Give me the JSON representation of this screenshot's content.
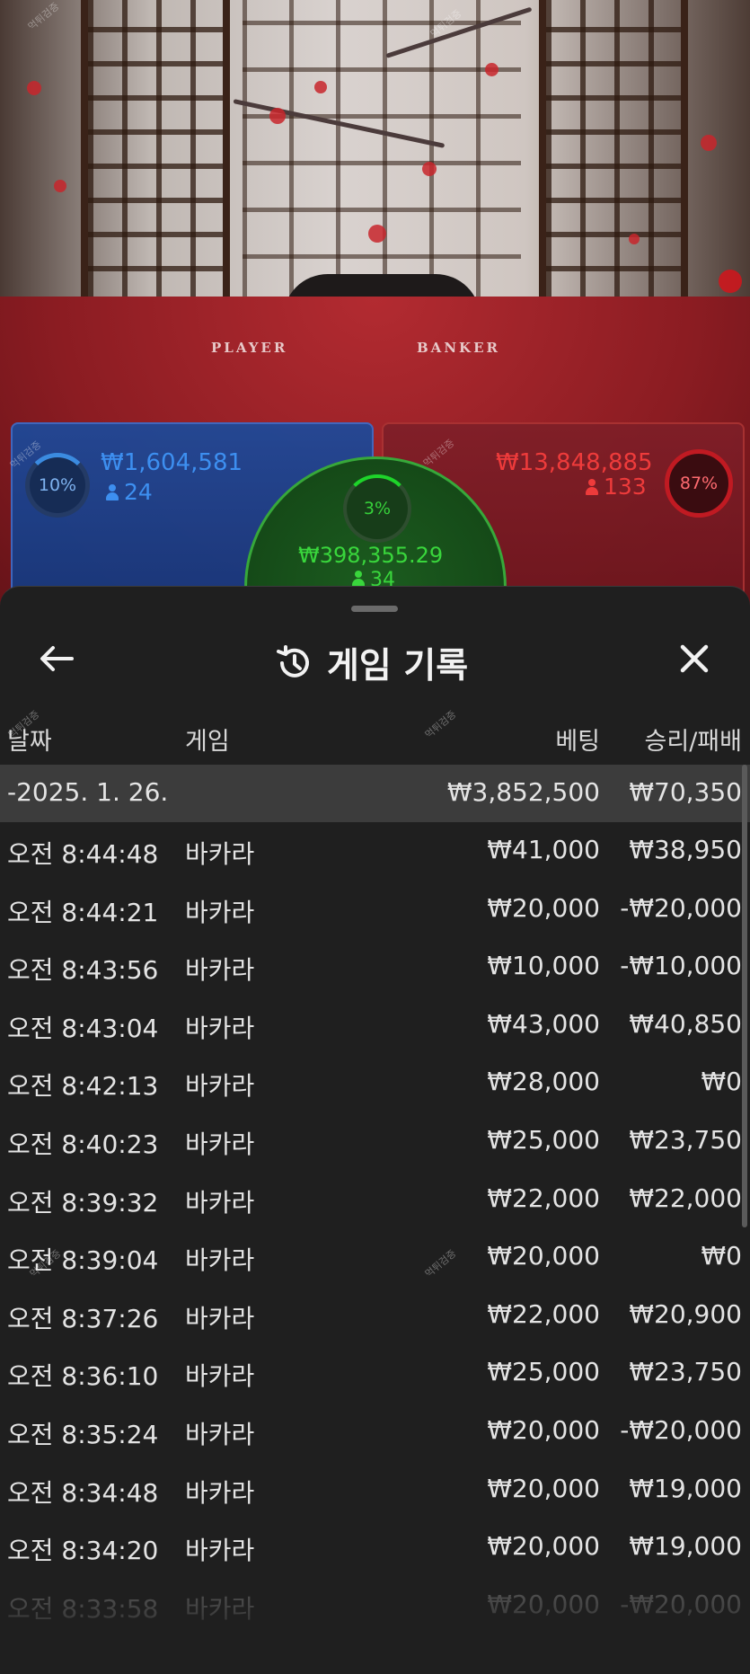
{
  "table": {
    "player_label": "PLAYER",
    "banker_label": "BANKER",
    "player": {
      "percent": "10%",
      "amount": "₩1,604,581",
      "players": "24"
    },
    "banker": {
      "percent": "87%",
      "amount": "₩13,848,885",
      "players": "133"
    },
    "tie": {
      "percent": "3%",
      "amount": "₩398,355.29",
      "players": "34"
    },
    "watermark": "먹튀검증"
  },
  "sheet": {
    "title": "게임 기록",
    "icons": {
      "back": "arrow-left-icon",
      "history": "history-icon",
      "close": "close-icon"
    },
    "columns": {
      "date": "날짜",
      "game": "게임",
      "bet": "베팅",
      "result": "승리/패배"
    },
    "total": {
      "date": "-2025. 1. 26.",
      "bet": "₩3,852,500",
      "result": "₩70,350"
    },
    "rows": [
      {
        "time": "오전 8:44:48",
        "game": "바카라",
        "bet": "₩41,000",
        "result": "₩38,950"
      },
      {
        "time": "오전 8:44:21",
        "game": "바카라",
        "bet": "₩20,000",
        "result": "-₩20,000"
      },
      {
        "time": "오전 8:43:56",
        "game": "바카라",
        "bet": "₩10,000",
        "result": "-₩10,000"
      },
      {
        "time": "오전 8:43:04",
        "game": "바카라",
        "bet": "₩43,000",
        "result": "₩40,850"
      },
      {
        "time": "오전 8:42:13",
        "game": "바카라",
        "bet": "₩28,000",
        "result": "₩0"
      },
      {
        "time": "오전 8:40:23",
        "game": "바카라",
        "bet": "₩25,000",
        "result": "₩23,750"
      },
      {
        "time": "오전 8:39:32",
        "game": "바카라",
        "bet": "₩22,000",
        "result": "₩22,000"
      },
      {
        "time": "오전 8:39:04",
        "game": "바카라",
        "bet": "₩20,000",
        "result": "₩0"
      },
      {
        "time": "오전 8:37:26",
        "game": "바카라",
        "bet": "₩22,000",
        "result": "₩20,900"
      },
      {
        "time": "오전 8:36:10",
        "game": "바카라",
        "bet": "₩25,000",
        "result": "₩23,750"
      },
      {
        "time": "오전 8:35:24",
        "game": "바카라",
        "bet": "₩20,000",
        "result": "-₩20,000"
      },
      {
        "time": "오전 8:34:48",
        "game": "바카라",
        "bet": "₩20,000",
        "result": "₩19,000"
      },
      {
        "time": "오전 8:34:20",
        "game": "바카라",
        "bet": "₩20,000",
        "result": "₩19,000"
      },
      {
        "time": "오전 8:33:58",
        "game": "바카라",
        "bet": "₩20,000",
        "result": "-₩20,000"
      }
    ]
  },
  "colors": {
    "background": "#1f1f1f",
    "total_row": "#3c3c3c",
    "player_blue": "#3d8ff0",
    "banker_red": "#ee3b3b",
    "tie_green": "#39d63c"
  }
}
